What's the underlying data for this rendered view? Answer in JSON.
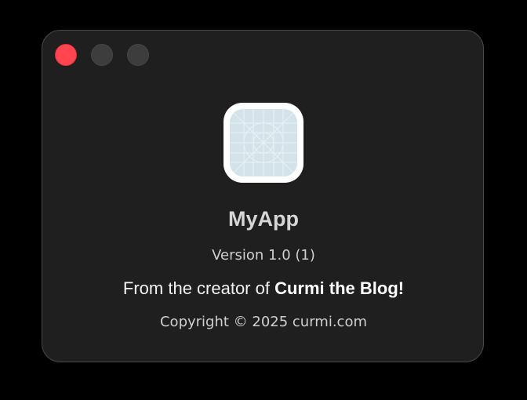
{
  "window": {
    "controls": {
      "close": "close",
      "minimize": "minimize",
      "zoom": "zoom"
    }
  },
  "about": {
    "app_icon": "app-placeholder-icon",
    "app_name": "MyApp",
    "version": "Version 1.0 (1)",
    "credit_prefix": "From the creator of ",
    "credit_link": "Curmi the Blog!",
    "copyright": "Copyright © 2025 curmi.com"
  },
  "colors": {
    "close_button": "#ff4550",
    "inactive_button": "#3d3d3d",
    "window_bg": "#1f1f1f",
    "icon_tile": "#d4e2ea"
  }
}
